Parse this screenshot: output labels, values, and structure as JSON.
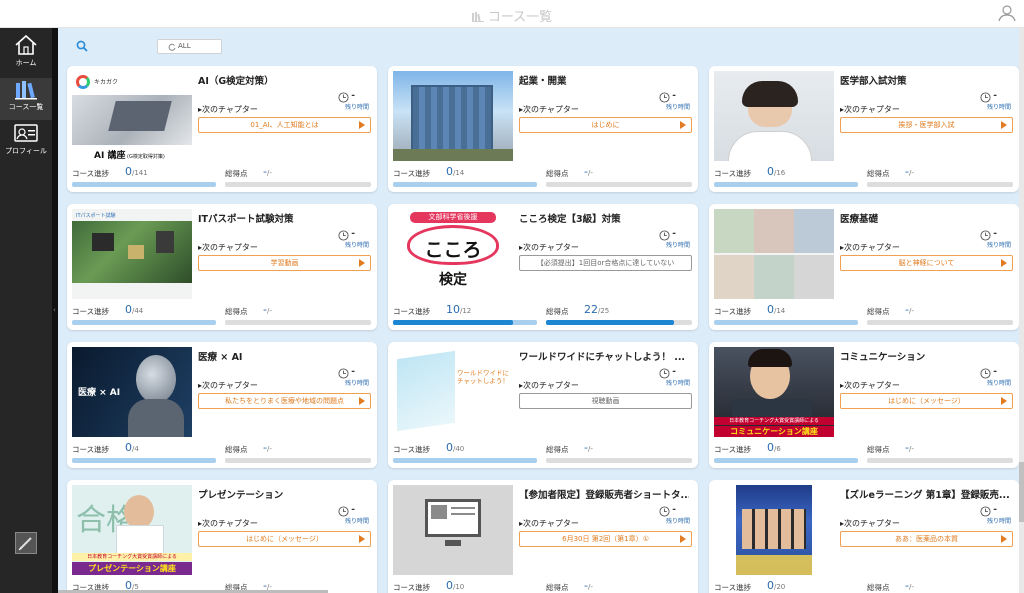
{
  "header": {
    "title": "コース一覧"
  },
  "sidebar": {
    "items": [
      {
        "label": "ホーム",
        "icon": "home-icon"
      },
      {
        "label": "コース一覧",
        "icon": "courses-icon"
      },
      {
        "label": "プロフィール",
        "icon": "profile-icon"
      }
    ],
    "active": "コース一覧"
  },
  "search": {
    "filter_label": "ALL"
  },
  "labels": {
    "next_chapter": "次のチャプター",
    "remaining": "残り時間",
    "progress": "コース進捗",
    "score": "総得点",
    "dash": "-"
  },
  "colors": {
    "accent": "#e07b1f",
    "progress_blue": "#1c86d2",
    "bg": "#dcecf8",
    "sidebar": "#262626"
  },
  "courses": [
    {
      "title": "AI（G検定対策）",
      "chapter": "01_AI、人工知能とは",
      "chapter_style": "orange",
      "progress": "0",
      "progress_total": "/141",
      "progress_frac": 0,
      "score": "-",
      "score_total": "/-",
      "score_frac": 0,
      "thumb_caption": "AI 講座",
      "thumb_sub": "(G検定取得対策)",
      "thumb_logo": "キカガク"
    },
    {
      "title": "起業・開業",
      "chapter": "はじめに",
      "chapter_style": "orange",
      "progress": "0",
      "progress_total": "/14",
      "progress_frac": 0,
      "score": "-",
      "score_total": "/-",
      "score_frac": 0,
      "thumb_caption": "",
      "thumb_sub": "",
      "thumb_logo": ""
    },
    {
      "title": "医学部入試対策",
      "chapter": "挨拶・医学部入試",
      "chapter_style": "orange",
      "progress": "0",
      "progress_total": "/16",
      "progress_frac": 0,
      "score": "-",
      "score_total": "/-",
      "score_frac": 0,
      "thumb_caption": "",
      "thumb_sub": "",
      "thumb_logo": ""
    },
    {
      "title": "ITパスポート試験対策",
      "chapter": "学習動画",
      "chapter_style": "orange",
      "progress": "0",
      "progress_total": "/44",
      "progress_frac": 0,
      "score": "-",
      "score_total": "/-",
      "score_frac": 0,
      "thumb_caption": "",
      "thumb_sub": "",
      "thumb_logo": "ITパスポート試験"
    },
    {
      "title": "こころ検定【3級】対策",
      "chapter": "【必須提出】1回目or合格点に達していない",
      "chapter_style": "gray",
      "progress": "10",
      "progress_total": "/12",
      "progress_frac": 0.8333,
      "score": "22",
      "score_total": "/25",
      "score_frac": 0.88,
      "thumb_caption": "こころ",
      "thumb_sub": "検定",
      "thumb_logo": "文部科学省後援"
    },
    {
      "title": "医療基礎",
      "chapter": "脳と神経について",
      "chapter_style": "orange",
      "progress": "0",
      "progress_total": "/14",
      "progress_frac": 0,
      "score": "-",
      "score_total": "/-",
      "score_frac": 0,
      "thumb_caption": "",
      "thumb_sub": "",
      "thumb_logo": ""
    },
    {
      "title": "医療 × AI",
      "chapter": "私たちをとりまく医療や地域の問題点",
      "chapter_style": "orange",
      "progress": "0",
      "progress_total": "/4",
      "progress_frac": 0,
      "score": "-",
      "score_total": "/-",
      "score_frac": 0,
      "thumb_caption": "医療 × AI",
      "thumb_sub": "",
      "thumb_logo": ""
    },
    {
      "title": "ワールドワイドにチャットしよう！ ...",
      "chapter": "視聴動画",
      "chapter_style": "gray",
      "progress": "0",
      "progress_total": "/40",
      "progress_frac": 0,
      "score": "-",
      "score_total": "/-",
      "score_frac": 0,
      "thumb_caption": "ワールドワイドに チャットしよう！",
      "thumb_sub": "",
      "thumb_logo": ""
    },
    {
      "title": "コミュニケーション",
      "chapter": "はじめに（メッセージ）",
      "chapter_style": "orange",
      "progress": "0",
      "progress_total": "/6",
      "progress_frac": 0,
      "score": "-",
      "score_total": "/-",
      "score_frac": 0,
      "thumb_caption": "コミュニケーション講座",
      "thumb_sub": "日本教育コーチング大賞受賞講師による",
      "thumb_logo": ""
    },
    {
      "title": "プレゼンテーション",
      "chapter": "はじめに（メッセージ）",
      "chapter_style": "orange",
      "progress": "0",
      "progress_total": "/5",
      "progress_frac": 0,
      "score": "-",
      "score_total": "/-",
      "score_frac": 0,
      "thumb_caption": "プレゼンテーション講座",
      "thumb_sub": "日本教育コーチング大賞受賞講師による",
      "thumb_logo": ""
    },
    {
      "title": "【参加者限定】登録販売者ショートタ...",
      "chapter": "6月30日 第2回（第1章）①",
      "chapter_style": "orange",
      "progress": "0",
      "progress_total": "/10",
      "progress_frac": 0,
      "score": "-",
      "score_total": "/-",
      "score_frac": 0,
      "thumb_caption": "",
      "thumb_sub": "",
      "thumb_logo": ""
    },
    {
      "title": "【ズルeラーニング 第1章】登録販売...",
      "chapter": "ああ：医薬品の本質",
      "chapter_style": "orange",
      "progress": "0",
      "progress_total": "/20",
      "progress_frac": 0,
      "score": "-",
      "score_total": "/-",
      "score_frac": 0,
      "thumb_caption": "",
      "thumb_sub": "",
      "thumb_logo": ""
    }
  ]
}
